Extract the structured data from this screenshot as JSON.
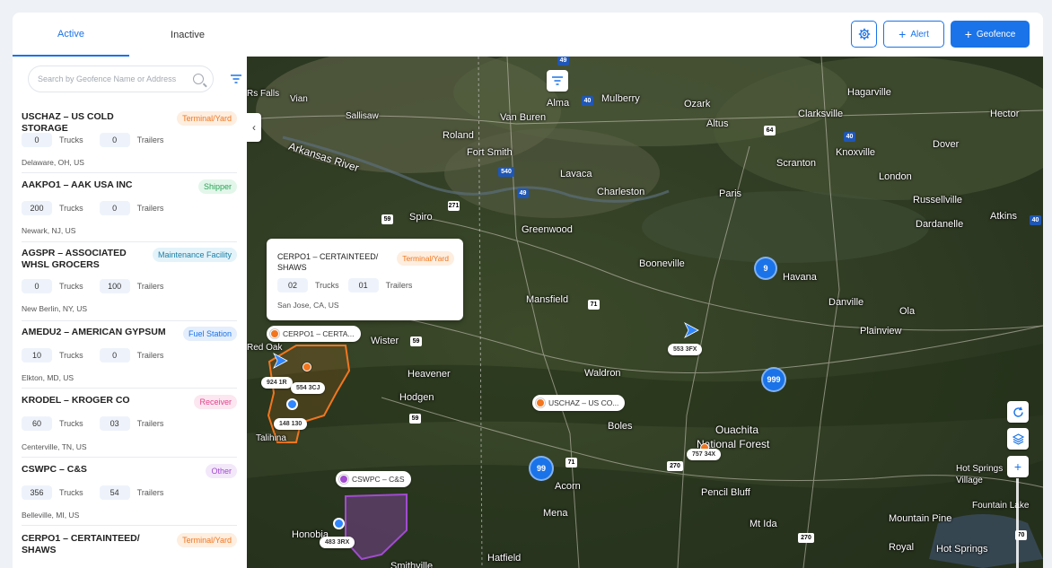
{
  "tabs": {
    "active": "Active",
    "inactive": "Inactive"
  },
  "toolbar": {
    "alert_label": "Alert",
    "geofence_label": "Geofence",
    "plus": "+"
  },
  "search": {
    "placeholder": "Search by Geofence Name or Address"
  },
  "units": {
    "trucks": "Trucks",
    "trailers": "Trailers"
  },
  "geofences": [
    {
      "name": "USCHAZ – US COLD STORAGE",
      "badge": "Terminal/Yard",
      "trucks": "0",
      "trailers": "0",
      "location": "Delaware, OH, US",
      "badge_color": "#f2761e",
      "badge_bg": "#fdeee0"
    },
    {
      "name": "AAKPO1 – AAK USA INC",
      "badge": "Shipper",
      "trucks": "200",
      "trailers": "0",
      "location": "Newark, NJ, US",
      "badge_color": "#27a456",
      "badge_bg": "#e3f6ea"
    },
    {
      "name": "AGSPR – ASSOCIATED WHSL GROCERS",
      "badge": "Maintenance Facility",
      "trucks": "0",
      "trailers": "100",
      "location": "New Berlin, NY, US",
      "badge_color": "#1b7fa6",
      "badge_bg": "#e3f3f9"
    },
    {
      "name": "AMEDU2 – AMERICAN GYPSUM",
      "badge": "Fuel Station",
      "trucks": "10",
      "trailers": "0",
      "location": "Elkton, MD, US",
      "badge_color": "#1a73e8",
      "badge_bg": "#e4eefc"
    },
    {
      "name": "KRODEL – KROGER CO",
      "badge": "Receiver",
      "trucks": "60",
      "trailers": "03",
      "location": "Centerville, TN, US",
      "badge_color": "#e0448b",
      "badge_bg": "#fce6f0"
    },
    {
      "name": "CSWPC – C&S",
      "badge": "Other",
      "trucks": "356",
      "trailers": "54",
      "location": "Belleville, MI, US",
      "badge_color": "#a24bd0",
      "badge_bg": "#f3e8fa"
    },
    {
      "name": "CERPO1 – CERTAINTEED/ SHAWS",
      "badge": "Terminal/Yard",
      "trucks": "",
      "trailers": "",
      "location": "",
      "badge_color": "#f2761e",
      "badge_bg": "#fdeee0"
    }
  ],
  "popup": {
    "name": "CERPO1 – CERTAINTEED/ SHAWS",
    "badge": "Terminal/Yard",
    "trucks": "02",
    "trailers": "01",
    "location": "San Jose, CA, US"
  },
  "map_pins": [
    {
      "label": "CERPO1 – CERTA...",
      "color": "#f2761e"
    },
    {
      "label": "USCHAZ – US CO...",
      "color": "#f2761e"
    },
    {
      "label": "CSWPC – C&S",
      "color": "#a24bd0"
    }
  ],
  "clusters": [
    "9",
    "999",
    "99"
  ],
  "vehicle_tags": [
    "553 3FX",
    "924 1R",
    "554 3CJ",
    "148 130",
    "757 34X",
    "483 3RX"
  ],
  "places": [
    "Vian",
    "Sallisaw",
    "Van Buren",
    "Roland",
    "Fort Smith",
    "Arkansas River",
    "Alma",
    "Mulberry",
    "Ozark",
    "Altus",
    "Clarksville",
    "Hagarville",
    "Hector",
    "Dover",
    "Knoxville",
    "Scranton",
    "Lavaca",
    "Charleston",
    "Paris",
    "London",
    "Russellville",
    "Dardanelle",
    "Atkins",
    "Spiro",
    "Greenwood",
    "Booneville",
    "Havana",
    "Mansfield",
    "Danville",
    "Ola",
    "Plainview",
    "Wister",
    "Heavener",
    "Hodgen",
    "Waldron",
    "Boles",
    "Ouachita",
    "National Forest",
    "Talihina",
    "Acorn",
    "Mena",
    "Pencil Bluff",
    "Mt Ida",
    "Hot Springs Village",
    "Fountain Lake",
    "Mountain Pine",
    "Royal",
    "Hot Springs",
    "Hatfield",
    "Smithville",
    "Honobia",
    "Red Oak",
    "Rs Falls"
  ],
  "highways": [
    "49",
    "40",
    "540",
    "49",
    "64",
    "40",
    "271",
    "59",
    "71",
    "59",
    "59",
    "71",
    "270",
    "270",
    "70",
    "40"
  ],
  "colors": {
    "accent": "#1a73e8",
    "terminal": "#f2761e",
    "other": "#a24bd0"
  }
}
